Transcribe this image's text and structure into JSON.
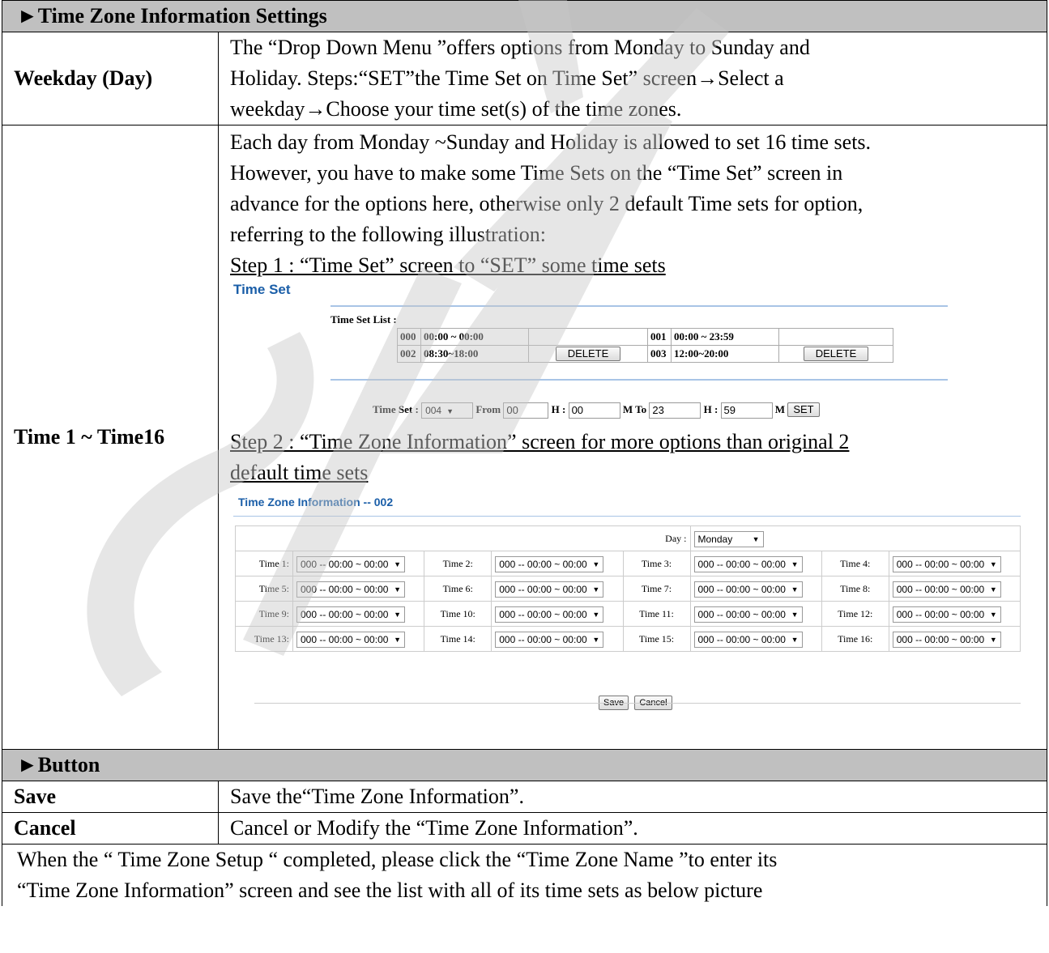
{
  "section1": {
    "title": "►Time Zone Information Settings",
    "rows": [
      {
        "label": "Weekday (Day)",
        "lines": [
          "The “Drop Down Menu ”offers options from Monday to Sunday and",
          "Holiday. Steps:“SET”the Time Set    on    Time Set” screen→Select a",
          "weekday→Choose your time set(s) of the time zones."
        ]
      },
      {
        "label": "Time 1 ~ Time16",
        "lines": [
          "Each day from Monday ~Sunday and Holiday is allowed to set 16 time sets.",
          "However, you have to make some Time Sets on the “Time Set” screen in",
          "advance for the options here, otherwise only 2 default Time sets for option,",
          "referring to the following illustration:"
        ],
        "step1": "Step 1 : “Time Set” screen to “SET” some time sets",
        "step2_line1": "Step 2 : “Time Zone Information” screen for more options than original 2",
        "step2_line2": "default time sets"
      }
    ]
  },
  "timeset_screen": {
    "title": "Time Set",
    "list_label": "Time Set List :",
    "rows": [
      {
        "a_id": "000",
        "a_range": "00:00 ~ 00:00",
        "a_btn": "",
        "b_id": "001",
        "b_range": "00:00 ~ 23:59",
        "b_btn": ""
      },
      {
        "a_id": "002",
        "a_range": "08:30~18:00",
        "a_btn": "DELETE",
        "b_id": "003",
        "b_range": "12:00~20:00",
        "b_btn": "DELETE"
      }
    ],
    "form": {
      "timeset_label": "Time Set :",
      "timeset_value": "004",
      "from_label": "From",
      "from_h": "00",
      "h_label1": "H :",
      "from_m": "00",
      "m_to_label": "M  To",
      "to_h": "23",
      "h_label2": "H :",
      "to_m": "59",
      "m_label": "M",
      "set_button": "SET"
    }
  },
  "timezone_screen": {
    "title": "Time Zone Information -- 002",
    "day_label": "Day :",
    "day_value": "Monday",
    "slot_value": "000 -- 00:00 ~ 00:00",
    "slots": [
      "Time 1:",
      "Time 2:",
      "Time 3:",
      "Time 4:",
      "Time 5:",
      "Time 6:",
      "Time 7:",
      "Time 8:",
      "Time 9:",
      "Time 10:",
      "Time 11:",
      "Time 12:",
      "Time 13:",
      "Time 14:",
      "Time 15:",
      "Time 16:"
    ],
    "save_button": "Save",
    "cancel_button": "Cancel"
  },
  "section2": {
    "title": "►Button",
    "rows": [
      {
        "label": "Save",
        "desc": "Save the“Time Zone Information”."
      },
      {
        "label": "Cancel",
        "desc": "Cancel or Modify the “Time Zone Information”."
      }
    ],
    "note_line1": "When the “ Time Zone Setup “ completed, please click the “Time Zone Name ”to enter its",
    "note_line2": "“Time Zone Information” screen and see the list with all of its time sets as below picture"
  }
}
